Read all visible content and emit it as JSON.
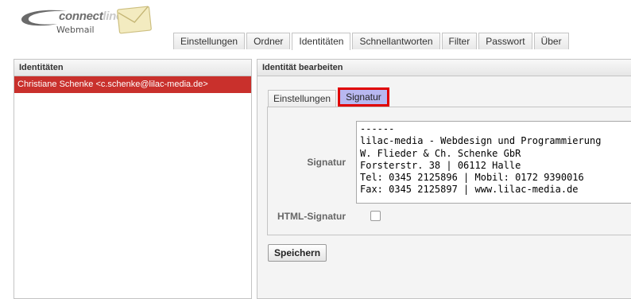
{
  "header": {
    "brand_main": "connect",
    "brand_accent": "line",
    "brand_sub": "Webmail",
    "logo_icon": "envelope-icon"
  },
  "main_tabs": [
    {
      "label": "Einstellungen",
      "active": false
    },
    {
      "label": "Ordner",
      "active": false
    },
    {
      "label": "Identitäten",
      "active": true
    },
    {
      "label": "Schnellantworten",
      "active": false
    },
    {
      "label": "Filter",
      "active": false
    },
    {
      "label": "Passwort",
      "active": false
    },
    {
      "label": "Über",
      "active": false
    }
  ],
  "identities_panel": {
    "title": "Identitäten",
    "items": [
      {
        "label": "Christiane Schenke <c.schenke@lilac-media.de>",
        "selected": true
      }
    ]
  },
  "edit_panel": {
    "title": "Identität bearbeiten",
    "sub_tabs": [
      {
        "label": "Einstellungen",
        "active": false
      },
      {
        "label": "Signatur",
        "active": true
      }
    ],
    "signature_label": "Signatur",
    "signature_value": "------\nlilac-media - Webdesign und Programmierung\nW. Flieder & Ch. Schenke GbR\nForsterstr. 38 | 06112 Halle\nTel: 0345 2125896 | Mobil: 0172 9390016\nFax: 0345 2125897 | www.lilac-media.de",
    "html_signature_label": "HTML-Signatur",
    "html_signature_checked": false,
    "save_label": "Speichern"
  },
  "colors": {
    "selection_red": "#c9302c",
    "active_subtab_bg": "#b8b8f0",
    "active_subtab_border": "#e00000"
  }
}
